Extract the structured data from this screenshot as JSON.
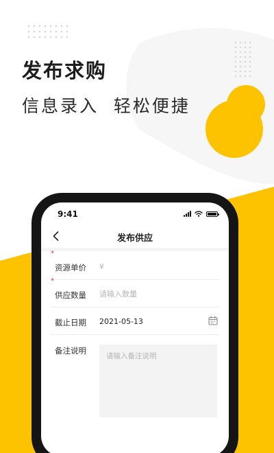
{
  "colors": {
    "accent": "#fdc200",
    "background": "#ffffff",
    "text": "#1d1d1d",
    "required": "#e33333"
  },
  "promo": {
    "headline": "发布求购",
    "subline": "信息录入  轻松便捷"
  },
  "phone": {
    "status_bar": {
      "time": "9:41",
      "icons": [
        "signal-icon",
        "wifi-icon",
        "battery-icon"
      ]
    },
    "nav": {
      "back_icon": "chevron-left-icon",
      "title": "发布供应"
    },
    "form": {
      "price": {
        "label": "资源单价",
        "required_mark": "*",
        "placeholder": "¥"
      },
      "quantity": {
        "label": "供应数量",
        "required_mark": "*",
        "placeholder": "请输入数量"
      },
      "deadline": {
        "label": "截止日期",
        "value": "2021-05-13",
        "icon": "calendar-icon"
      },
      "remark": {
        "label": "备注说明",
        "placeholder": "请输入备注说明"
      }
    }
  }
}
